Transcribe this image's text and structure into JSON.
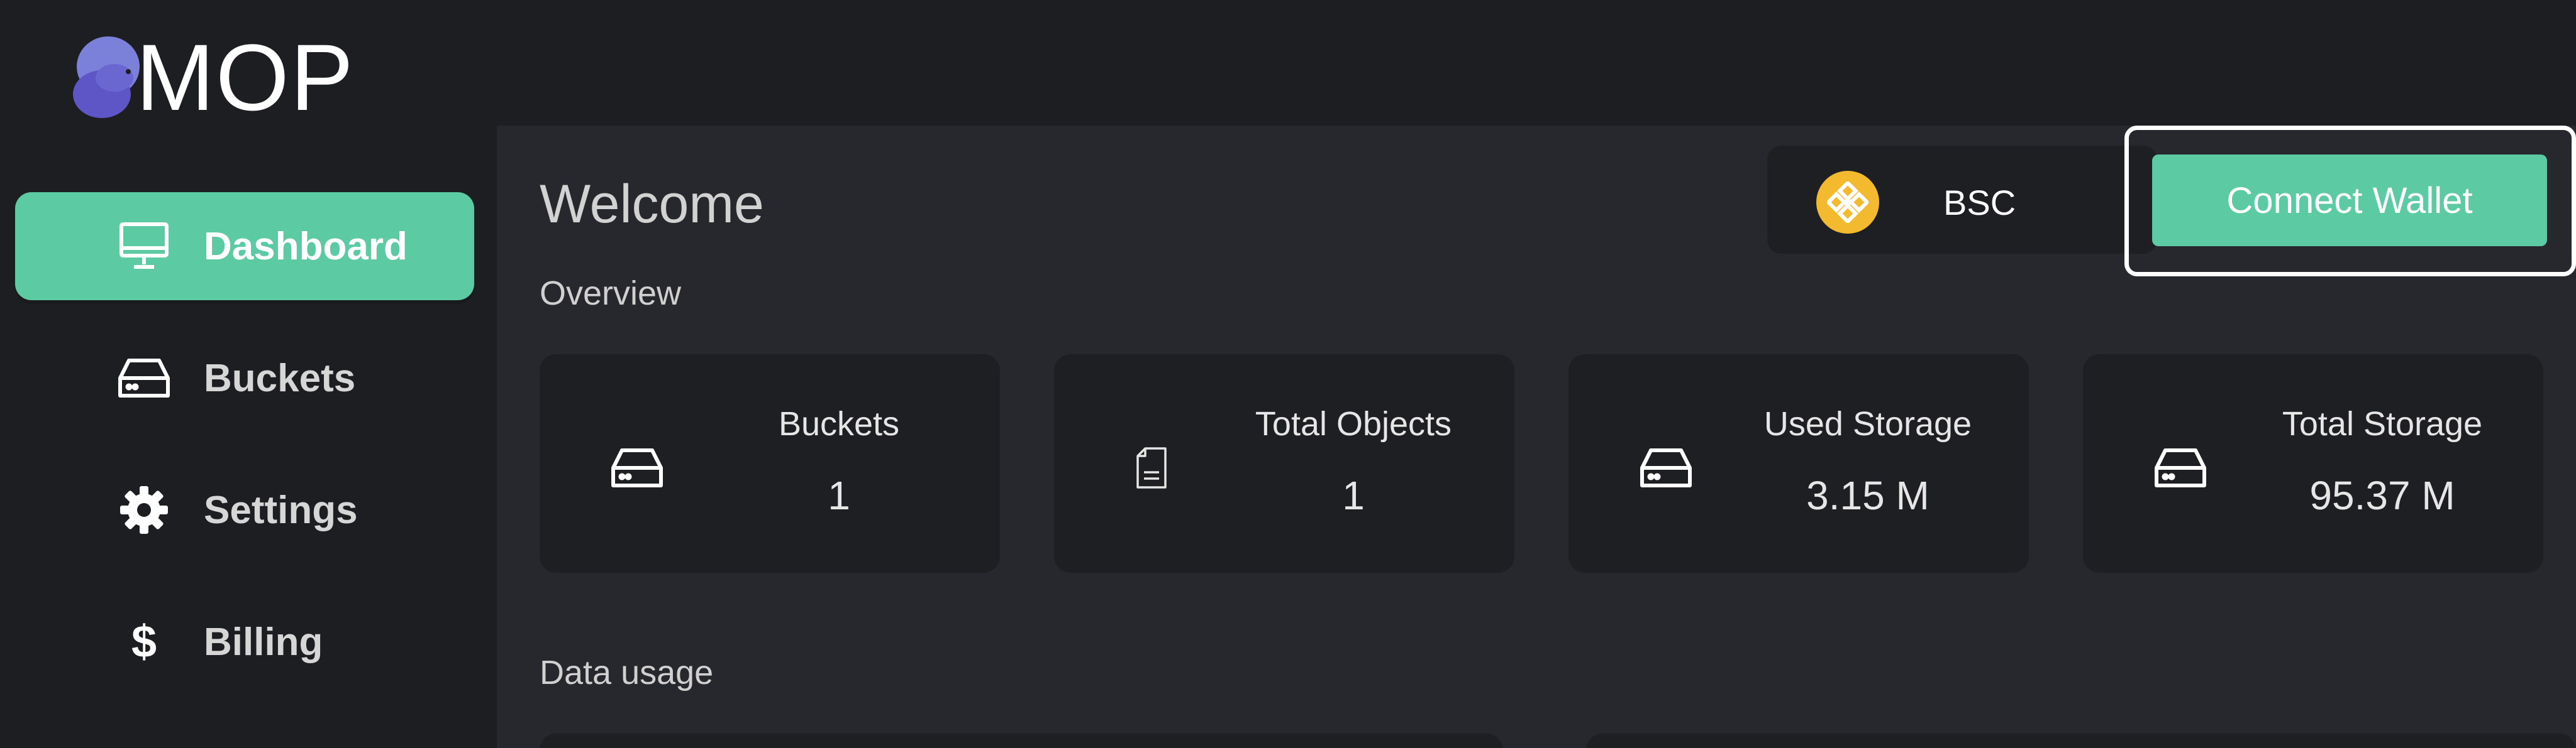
{
  "app": {
    "name": "MOP"
  },
  "sidebar": {
    "items": [
      {
        "label": "Dashboard",
        "icon": "monitor-icon",
        "active": true
      },
      {
        "label": "Buckets",
        "icon": "drive-icon",
        "active": false
      },
      {
        "label": "Settings",
        "icon": "gear-icon",
        "active": false
      },
      {
        "label": "Billing",
        "icon": "dollar-icon",
        "symbol": "$",
        "active": false
      }
    ]
  },
  "header": {
    "title": "Welcome",
    "network": {
      "label": "BSC",
      "icon": "binance-icon"
    },
    "connect_label": "Connect Wallet"
  },
  "overview": {
    "label": "Overview",
    "cards": [
      {
        "title": "Buckets",
        "value": "1",
        "icon": "drive-icon"
      },
      {
        "title": "Total Objects",
        "value": "1",
        "icon": "document-icon"
      },
      {
        "title": "Used Storage",
        "value": "3.15 M",
        "icon": "drive-icon"
      },
      {
        "title": "Total Storage",
        "value": "95.37 M",
        "icon": "drive-icon"
      }
    ]
  },
  "data_usage": {
    "label": "Data usage"
  },
  "colors": {
    "accent": "#5ccaa2",
    "background": "#1d1e22",
    "panel": "#27282d",
    "card": "#1e1f23",
    "binance": "#f3ba2f",
    "logo": "#7b7fd8"
  }
}
